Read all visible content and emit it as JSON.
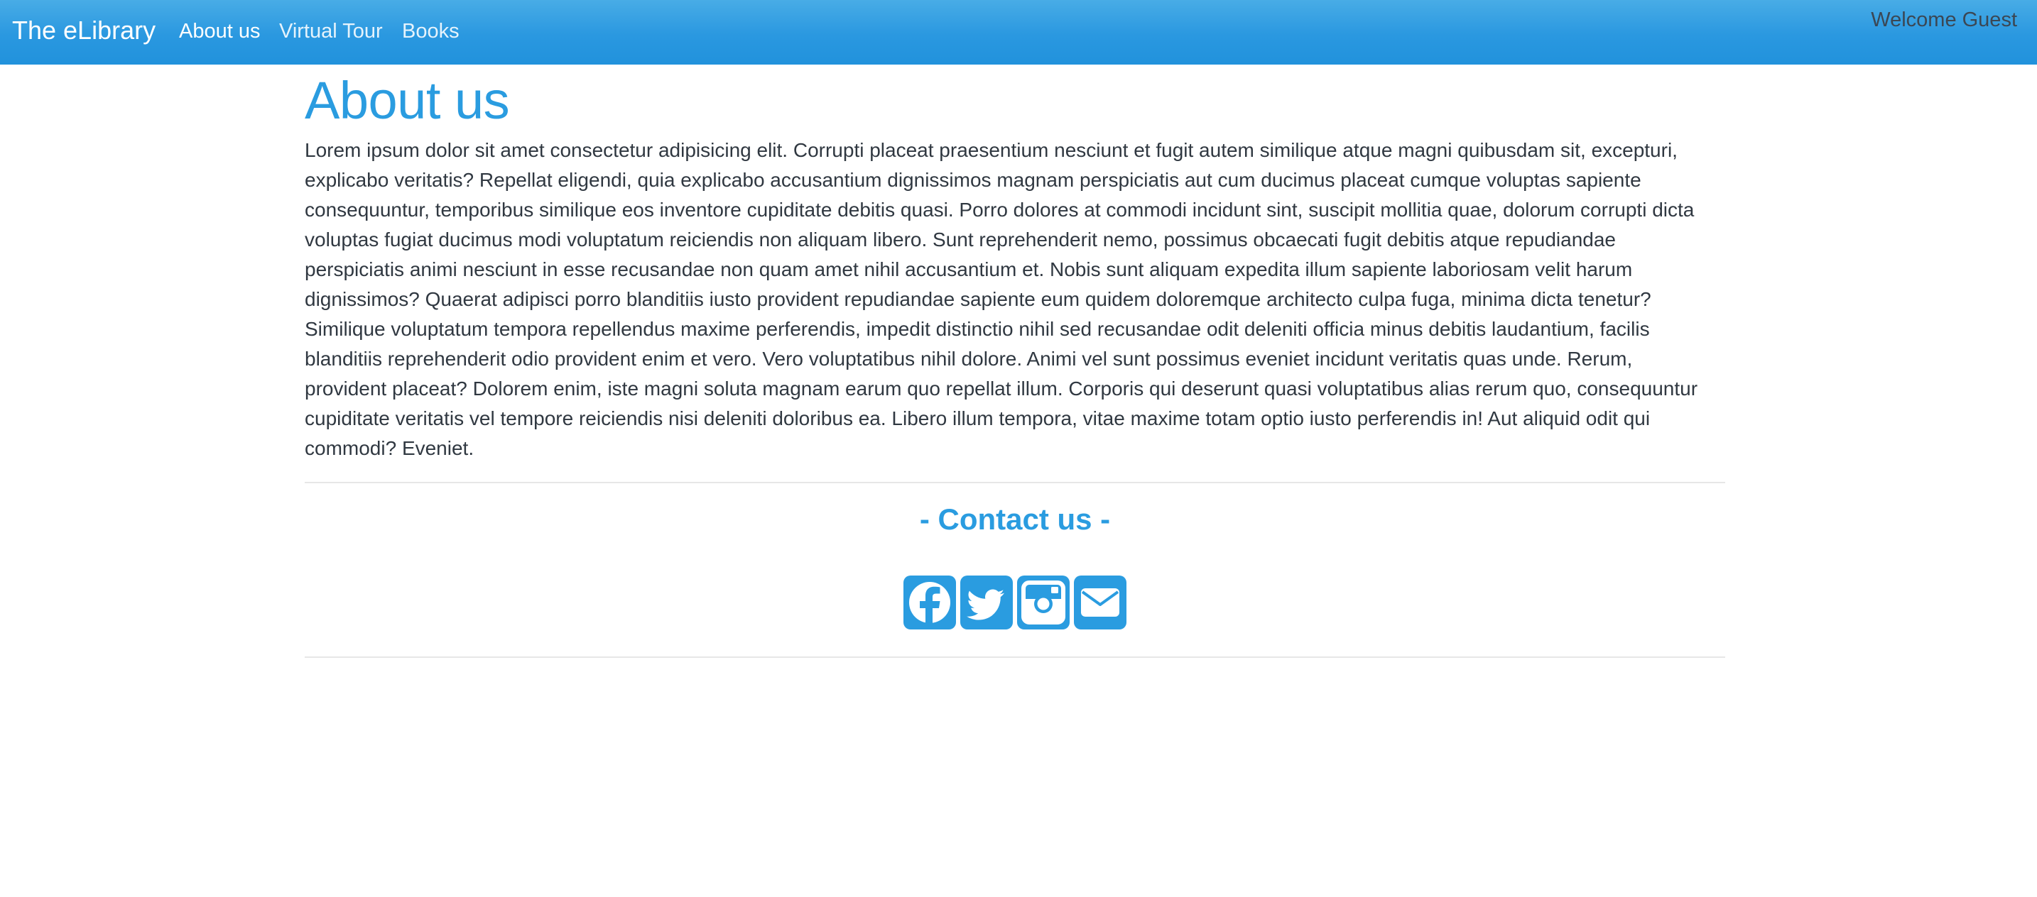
{
  "navbar": {
    "brand": "The eLibrary",
    "links": [
      {
        "label": "About us",
        "active": true
      },
      {
        "label": "Virtual Tour",
        "active": false
      },
      {
        "label": "Books",
        "active": false
      }
    ],
    "welcome": "Welcome Guest"
  },
  "colors": {
    "navbar": "#2a98e0",
    "accent": "#2a9ce0",
    "text": "#303841"
  },
  "main": {
    "title": "About us",
    "paragraph": "Lorem ipsum dolor sit amet consectetur adipisicing elit. Corrupti placeat praesentium nesciunt et fugit autem similique atque magni quibusdam sit, excepturi, explicabo veritatis? Repellat eligendi, quia explicabo accusantium dignissimos magnam perspiciatis aut cum ducimus placeat cumque voluptas sapiente consequuntur, temporibus similique eos inventore cupiditate debitis quasi. Porro dolores at commodi incidunt sint, suscipit mollitia quae, dolorum corrupti dicta voluptas fugiat ducimus modi voluptatum reiciendis non aliquam libero. Sunt reprehenderit nemo, possimus obcaecati fugit debitis atque repudiandae perspiciatis animi nesciunt in esse recusandae non quam amet nihil accusantium et. Nobis sunt aliquam expedita illum sapiente laboriosam velit harum dignissimos? Quaerat adipisci porro blanditiis iusto provident repudiandae sapiente eum quidem doloremque architecto culpa fuga, minima dicta tenetur? Similique voluptatum tempora repellendus maxime perferendis, impedit distinctio nihil sed recusandae odit deleniti officia minus debitis laudantium, facilis blanditiis reprehenderit odio provident enim et vero. Vero voluptatibus nihil dolore. Animi vel sunt possimus eveniet incidunt veritatis quas unde. Rerum, provident placeat? Dolorem enim, iste magni soluta magnam earum quo repellat illum. Corporis qui deserunt quasi voluptatibus alias rerum quo, consequuntur cupiditate veritatis vel tempore reiciendis nisi deleniti doloribus ea. Libero illum tempora, vitae maxime totam optio iusto perferendis in! Aut aliquid odit qui commodi? Eveniet."
  },
  "contact": {
    "title": "- Contact us -",
    "icons": [
      "facebook-icon",
      "twitter-icon",
      "instagram-icon",
      "envelope-icon"
    ]
  }
}
